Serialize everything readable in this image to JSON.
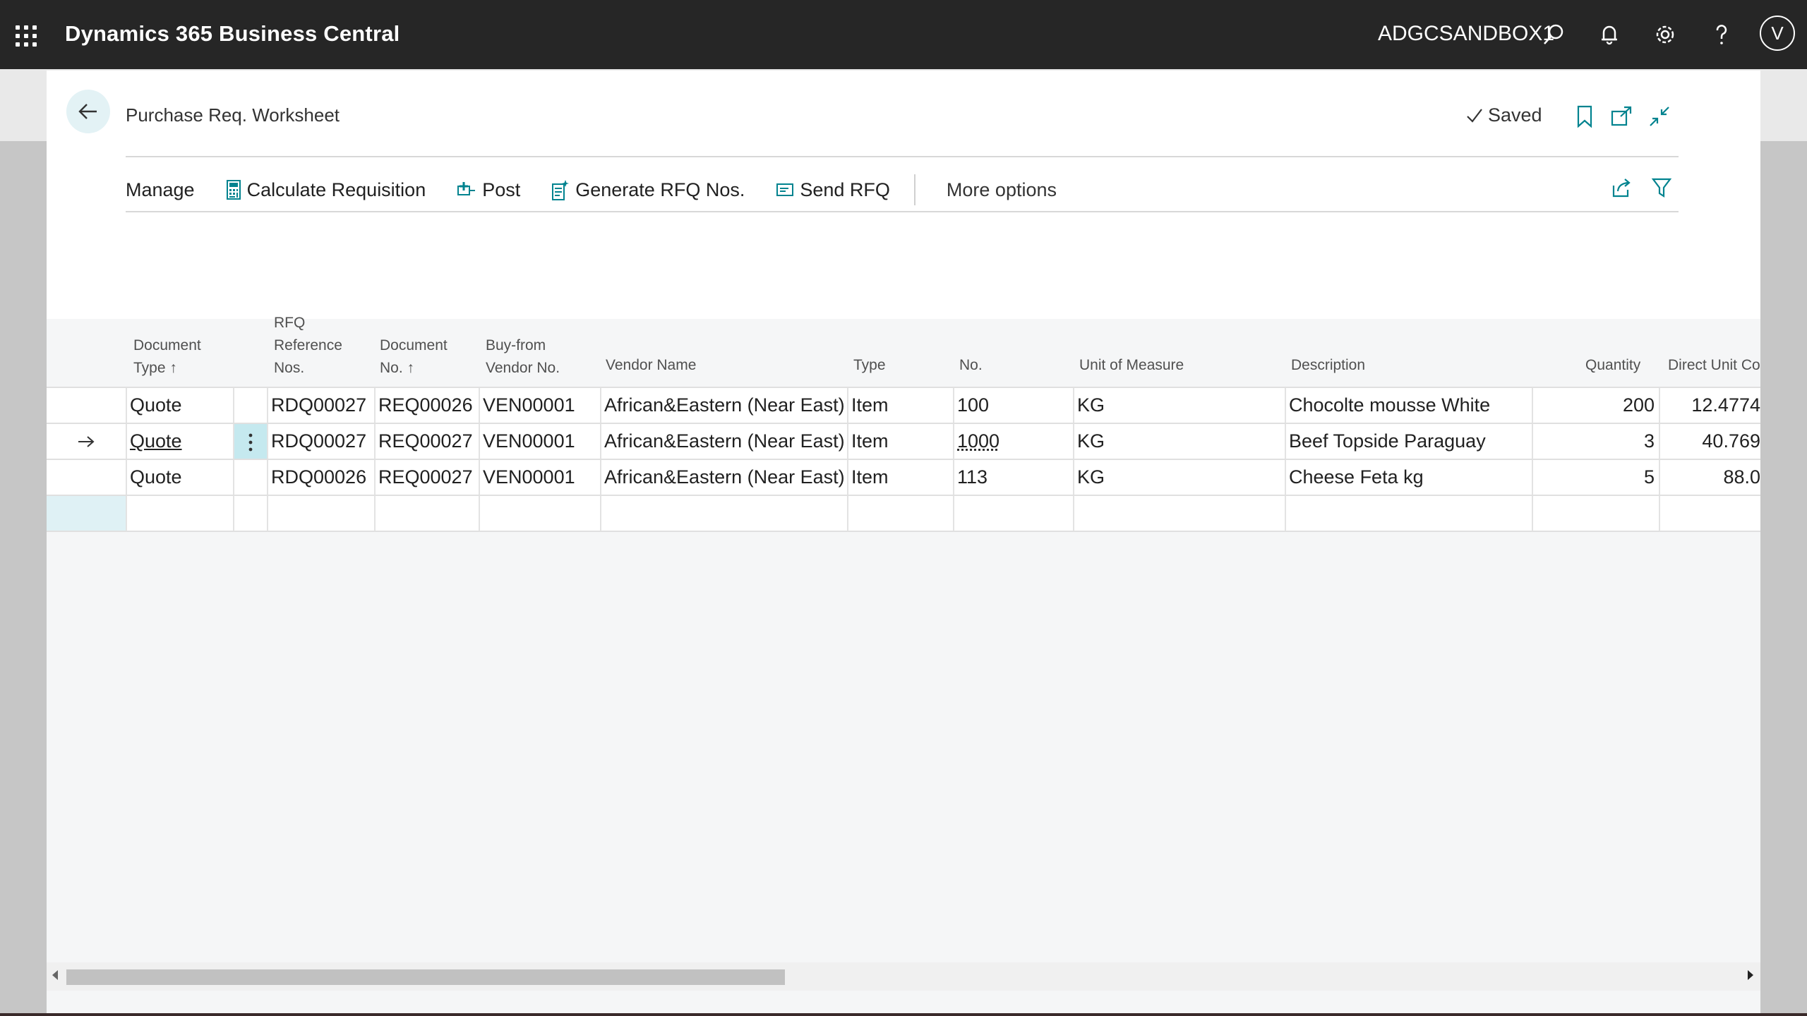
{
  "appbar": {
    "title": "Dynamics 365 Business Central",
    "environment": "ADGCSANDBOX1",
    "avatar_initial": "V",
    "icons": [
      "app-launcher-icon",
      "search-icon",
      "bell-icon",
      "gear-icon",
      "help-icon"
    ]
  },
  "page": {
    "title": "Purchase Req. Worksheet",
    "status": "Saved"
  },
  "actions": {
    "manage": "Manage",
    "calculate_requisition": "Calculate Requisition",
    "post": "Post",
    "generate_rfq": "Generate RFQ Nos.",
    "send_rfq": "Send RFQ",
    "more_options": "More options"
  },
  "columns": {
    "document_type": [
      "Document",
      "Type ↑"
    ],
    "rfq_ref": [
      "RFQ",
      "Reference",
      "Nos."
    ],
    "document_no": [
      "Document",
      "No. ↑"
    ],
    "vendor_no": [
      "Buy-from",
      "Vendor No."
    ],
    "vendor_name": "Vendor Name",
    "type": "Type",
    "no": "No.",
    "uom": "Unit of Measure",
    "description": "Description",
    "quantity": "Quantity",
    "direct_unit_cost": "Direct Unit Cos"
  },
  "rows": [
    {
      "doc_type": "Quote",
      "rfq_ref": "RDQ00027",
      "doc_no": "REQ00026",
      "vendor_no": "VEN00001",
      "vendor_name": "African&Eastern (Near East) LLC",
      "type": "Item",
      "no": "100",
      "uom": "KG",
      "description": "Chocolte mousse White",
      "quantity": "200",
      "cost": "12.4774"
    },
    {
      "doc_type": "Quote",
      "rfq_ref": "RDQ00027",
      "doc_no": "REQ00027",
      "vendor_no": "VEN00001",
      "vendor_name": "African&Eastern (Near East) LLC",
      "type": "Item",
      "no": "1000",
      "uom": "KG",
      "description": "Beef Topside Paraguay",
      "quantity": "3",
      "cost": "40.769"
    },
    {
      "doc_type": "Quote",
      "rfq_ref": "RDQ00026",
      "doc_no": "REQ00027",
      "vendor_no": "VEN00001",
      "vendor_name": "African&Eastern (Near East) LLC",
      "type": "Item",
      "no": "113",
      "uom": "KG",
      "description": "Cheese Feta kg",
      "quantity": "5",
      "cost": "88.0"
    }
  ],
  "colors": {
    "appbar": "#262626",
    "accent": "#00838f",
    "selected_cell": "#c5e9ef"
  }
}
